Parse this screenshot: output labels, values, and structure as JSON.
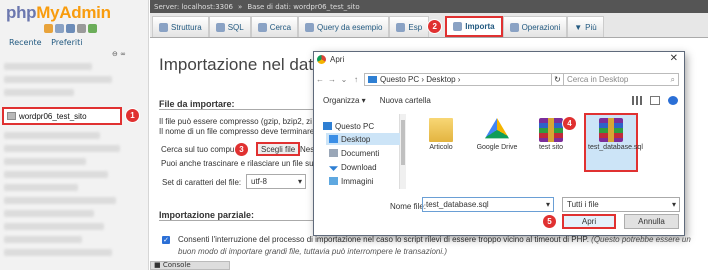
{
  "left_panel": {
    "logo_part1": "php",
    "logo_part2": "MyAdmin",
    "links": [
      "Recente",
      "Preferiti"
    ],
    "collapse_label": "⊖ ∞",
    "db_item_label": "wordpr06_test_sito"
  },
  "topbar": {
    "server": "Server: localhost:3306",
    "database": "Base di dati: wordpr06_test_sito"
  },
  "tabs": [
    {
      "label": "Struttura",
      "active": false
    },
    {
      "label": "SQL",
      "active": false
    },
    {
      "label": "Cerca",
      "active": false
    },
    {
      "label": "Query da esempio",
      "active": false
    },
    {
      "label": "Esp",
      "active": false
    },
    {
      "label": "Importa",
      "active": true
    },
    {
      "label": "Operazioni",
      "active": false
    },
    {
      "label": "Più",
      "active": false
    }
  ],
  "main": {
    "page_title": "Importazione nel data",
    "files_heading": "File da importare:",
    "compress_line1": "Il file può essere compresso (gzip, bzip2, zi",
    "compress_line2": "Il nome di un file compresso deve terminare",
    "search_prefix": "Cerca sul tuo compu",
    "choose_file": "Scegli file",
    "search_suffix": "Nes",
    "drag_text": "Puoi anche trascinare e rilasciare un file su",
    "charset_label": "Set di caratteri del file:",
    "charset_value": "utf-8",
    "partial_heading": "Importazione parziale:",
    "allow_text": "Consenti l'interruzione del processo di importazione nel caso lo script rilevi di essere troppo vicino al timeout di PHP.",
    "allow_hint": "(Questo potrebbe essere un buon modo di importare grandi file, tuttavia può interrompere le transazioni.)",
    "console": "Console"
  },
  "dialog": {
    "title": "Apri",
    "breadcrumb": "Questo PC  ›  Desktop  ›",
    "search_placeholder": "Cerca in Desktop",
    "organize": "Organizza ▾",
    "new_folder": "Nuova cartella",
    "sidebar": [
      {
        "label": "Questo PC",
        "selected": false
      },
      {
        "label": "Desktop",
        "selected": true
      },
      {
        "label": "Documenti",
        "selected": false
      },
      {
        "label": "Download",
        "selected": false
      },
      {
        "label": "Immagini",
        "selected": false
      }
    ],
    "files": [
      {
        "label": "Articolo",
        "icon": "folder-icon"
      },
      {
        "label": "Google Drive",
        "icon": "google-drive-icon"
      },
      {
        "label": "test sito",
        "icon": "winrar-archive-icon"
      },
      {
        "label": "test_database.sql",
        "icon": "winrar-archive-icon"
      }
    ],
    "filename_label": "Nome file:",
    "filename_value": "test_database.sql",
    "filetype_value": "Tutti i file",
    "open_label": "Apri",
    "cancel_label": "Annulla"
  },
  "badges": [
    "1",
    "2",
    "3",
    "4",
    "5"
  ],
  "colors": {
    "highlight": "#e03131",
    "link": "#235a81"
  }
}
